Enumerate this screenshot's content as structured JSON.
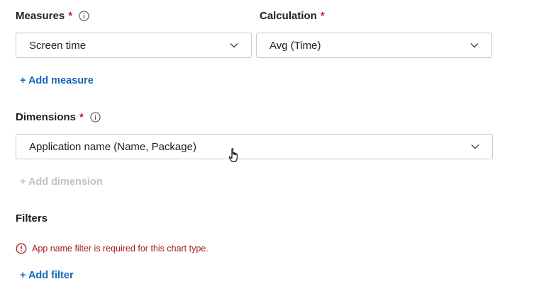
{
  "measures": {
    "label": "Measures",
    "required_mark": "*",
    "info_icon": "info-icon",
    "select_value": "Screen time",
    "add_label": "+ Add measure"
  },
  "calculation": {
    "label": "Calculation",
    "required_mark": "*",
    "select_value": "Avg (Time)"
  },
  "dimensions": {
    "label": "Dimensions",
    "required_mark": "*",
    "info_icon": "info-icon",
    "select_value": "Application name (Name, Package)",
    "add_label": "+ Add dimension"
  },
  "filters": {
    "label": "Filters",
    "error_text": "App name filter is required for this chart type.",
    "error_icon": "error-icon",
    "add_label": "+ Add filter"
  },
  "colors": {
    "accent": "#1467b8",
    "required": "#d21c1c",
    "error": "#a8191c",
    "disabled": "#c2c2c2"
  }
}
